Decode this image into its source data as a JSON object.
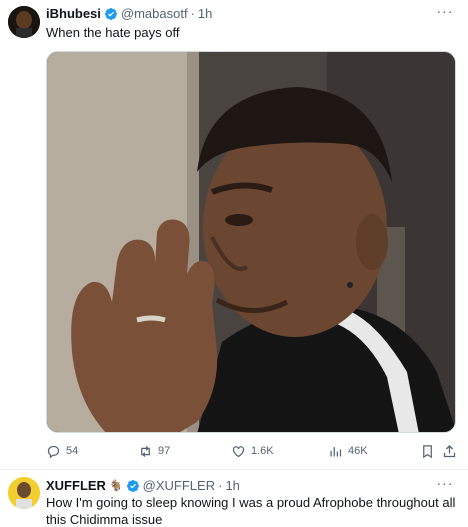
{
  "tweet1": {
    "display_name": "iBhubesi",
    "handle": "@mabasotf",
    "separator": "·",
    "time": "1h",
    "text": "When the hate pays off",
    "more": "···",
    "media_icon": "meme-photo-man-peeking-behind-wall",
    "actions": {
      "replies": "54",
      "retweets": "97",
      "likes": "1.6K",
      "views": "46K"
    }
  },
  "tweet2": {
    "display_name": "XUFFLER",
    "badge_emoji": "🐐",
    "handle": "@XUFFLER",
    "separator": "·",
    "time": "1h",
    "text": "How I'm going to sleep knowing I was a proud Afrophobe throughout all this Chidimma issue",
    "more": "···"
  },
  "colors": {
    "verified": "#1d9bf0",
    "secondary_text": "#536471",
    "primary_text": "#0f1419"
  }
}
